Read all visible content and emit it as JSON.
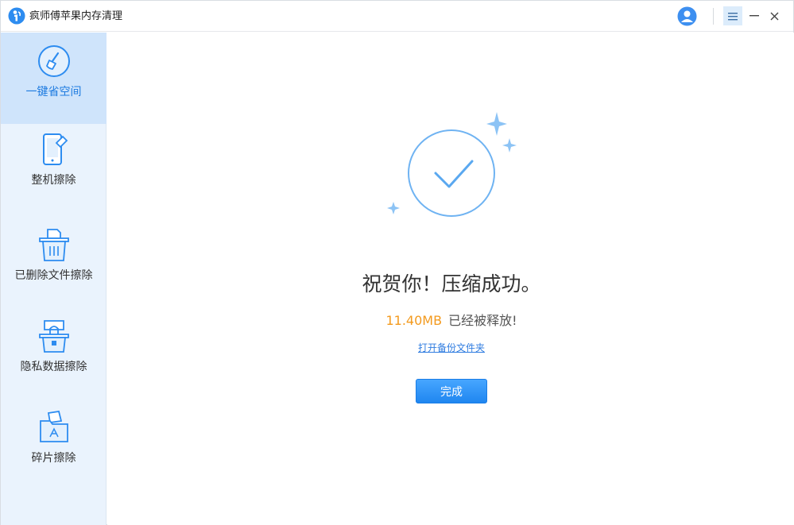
{
  "app": {
    "title": "疯师傅苹果内存清理",
    "accent_color": "#1f86f0",
    "logo_icon": "app-logo-icon"
  },
  "titlebar": {
    "user_icon": "user-avatar-icon",
    "menu_icon": "hamburger-menu-icon",
    "minimize_icon": "minimize-icon",
    "close_icon": "close-icon"
  },
  "sidebar": {
    "items": [
      {
        "label": "一键省空间",
        "icon": "broom-icon",
        "active": true
      },
      {
        "label": "整机擦除",
        "icon": "phone-eraser-icon",
        "active": false
      },
      {
        "label": "已删除文件擦除",
        "icon": "trash-file-icon",
        "active": false
      },
      {
        "label": "隐私数据擦除",
        "icon": "privacy-lock-icon",
        "active": false
      },
      {
        "label": "碎片擦除",
        "icon": "fragment-folder-icon",
        "active": false
      }
    ]
  },
  "main": {
    "headline": "祝贺你！压缩成功。",
    "freed_size": "11.40MB",
    "freed_text": "已经被释放!",
    "open_backup_link": "打开备份文件夹",
    "done_button": "完成",
    "size_color": "#f39a1e"
  }
}
